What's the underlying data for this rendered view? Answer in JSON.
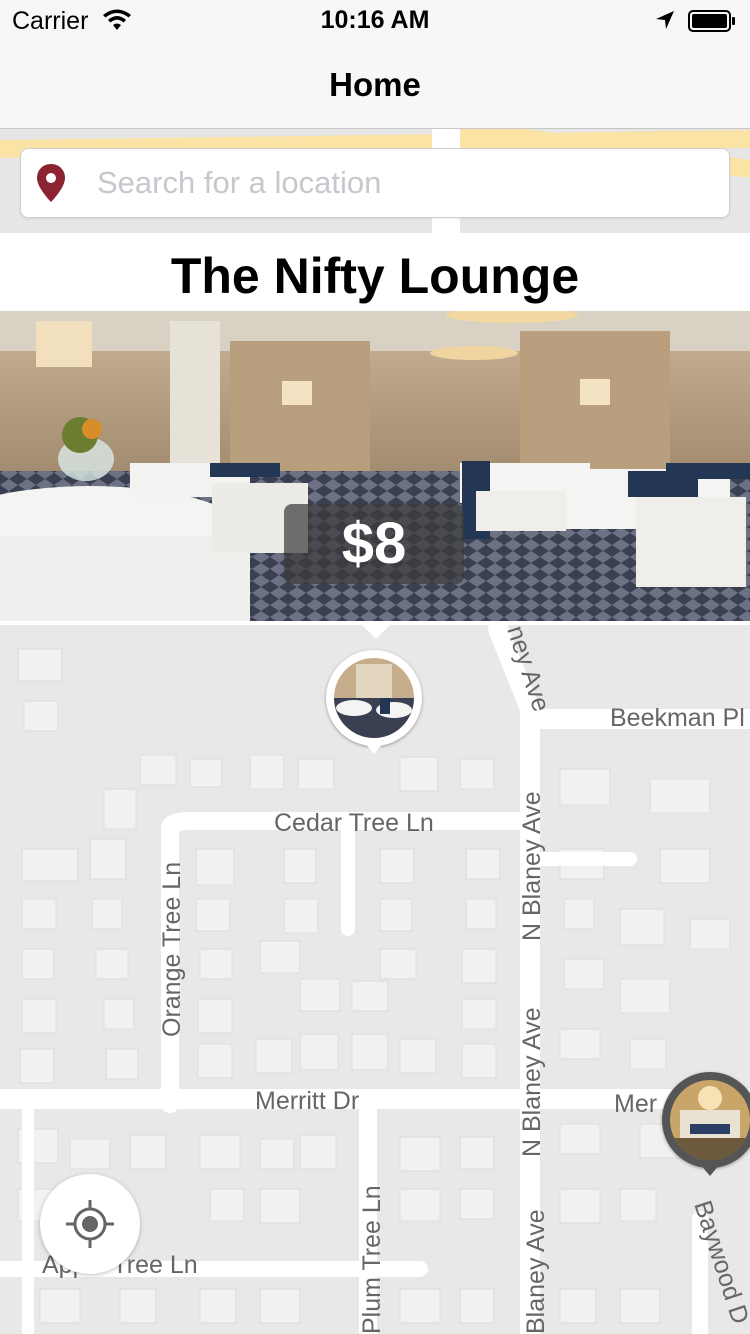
{
  "status_bar": {
    "carrier": "Carrier",
    "time": "10:16 AM",
    "icons": [
      "wifi-icon",
      "location-arrow-icon",
      "battery-icon"
    ]
  },
  "nav": {
    "title": "Home"
  },
  "search": {
    "placeholder": "Search for a location",
    "value": "",
    "icon": "map-pin-icon",
    "pin_color": "#8b2330"
  },
  "listing": {
    "name": "The Nifty Lounge",
    "price": "$8",
    "photo": "restaurant-dining-room-photo"
  },
  "map": {
    "street_labels": [
      "Beekman Pl",
      "Cedar Tree Ln",
      "Orange Tree Ln",
      "N Blaney Ave",
      "N Blaney Ave",
      "ney Ave",
      "Merritt Dr",
      "Mer",
      "Baywood D",
      "Plum Tree Ln",
      "Apple Tree Ln",
      "Blaney Ave"
    ]
  },
  "controls": {
    "locate_icon": "crosshair-icon"
  }
}
